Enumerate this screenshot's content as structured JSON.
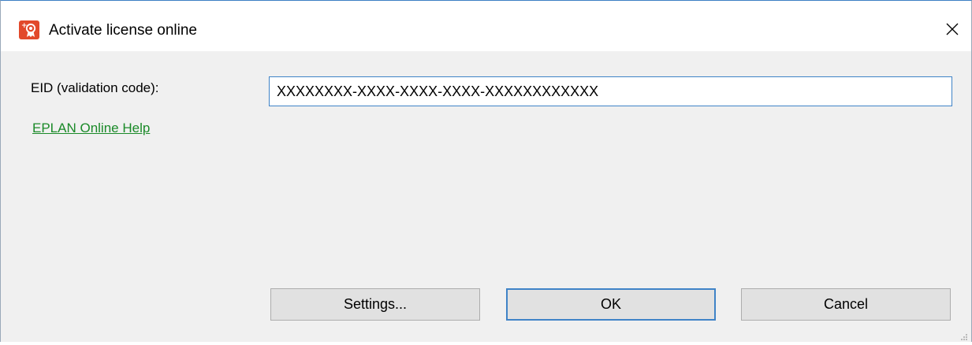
{
  "window": {
    "title": "Activate license online",
    "icon": "license-certificate-icon",
    "close_icon": "close-icon"
  },
  "form": {
    "eid_label": "EID (validation code):",
    "eid_value": "XXXXXXXX-XXXX-XXXX-XXXX-XXXXXXXXXXXX",
    "help_link": "EPLAN Online Help"
  },
  "buttons": {
    "settings": "Settings...",
    "ok": "OK",
    "cancel": "Cancel"
  },
  "colors": {
    "accent": "#3f83c7",
    "link": "#1a8a28",
    "icon_red": "#e2492b",
    "dialog_bg": "#f0f0f0"
  }
}
